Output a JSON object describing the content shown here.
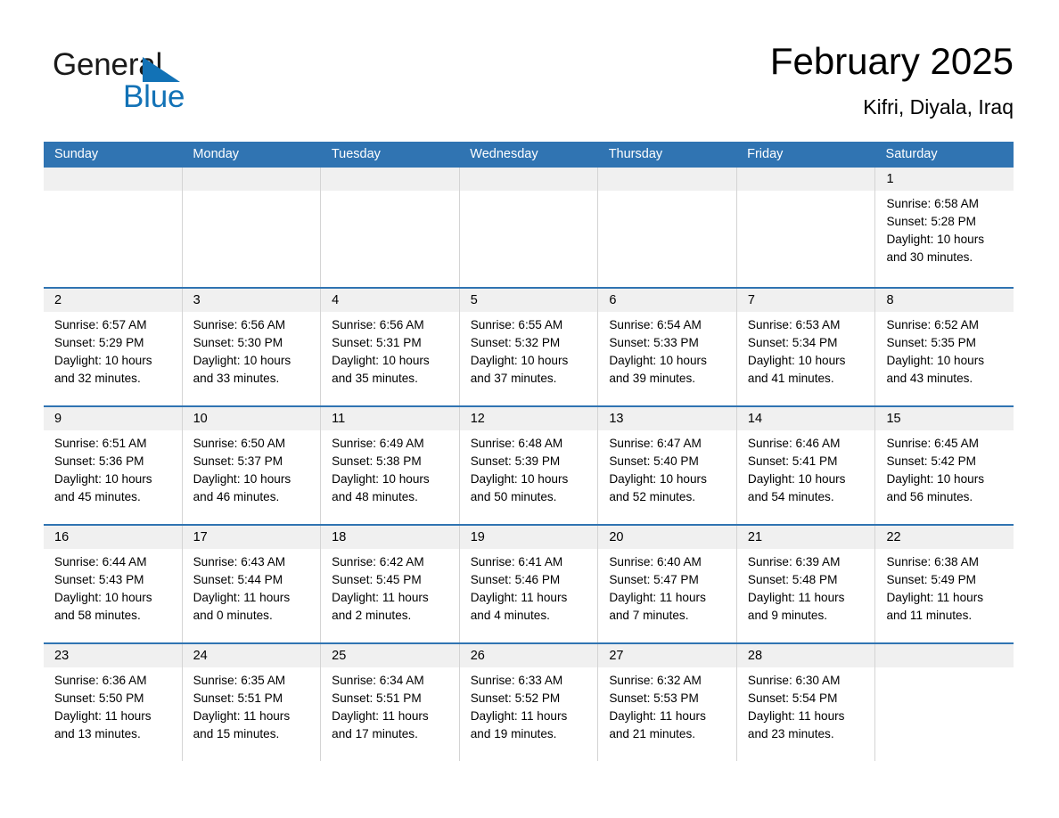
{
  "logo": {
    "word_one": "General",
    "word_two": "Blue",
    "triangle_color": "#1272b6"
  },
  "header": {
    "title": "February 2025",
    "subtitle": "Kifri, Diyala, Iraq",
    "accent_color": "#3074b2",
    "date_band_color": "#f0f0f0"
  },
  "weekday_headers": [
    "Sunday",
    "Monday",
    "Tuesday",
    "Wednesday",
    "Thursday",
    "Friday",
    "Saturday"
  ],
  "labels": {
    "sunrise_prefix": "Sunrise: ",
    "sunset_prefix": "Sunset: ",
    "daylight_prefix": "Daylight: "
  },
  "weeks": [
    [
      {
        "day": "",
        "sunrise": "",
        "sunset": "",
        "daylight": "",
        "empty": true
      },
      {
        "day": "",
        "sunrise": "",
        "sunset": "",
        "daylight": "",
        "empty": true
      },
      {
        "day": "",
        "sunrise": "",
        "sunset": "",
        "daylight": "",
        "empty": true
      },
      {
        "day": "",
        "sunrise": "",
        "sunset": "",
        "daylight": "",
        "empty": true
      },
      {
        "day": "",
        "sunrise": "",
        "sunset": "",
        "daylight": "",
        "empty": true
      },
      {
        "day": "",
        "sunrise": "",
        "sunset": "",
        "daylight": "",
        "empty": true
      },
      {
        "day": "1",
        "sunrise": "Sunrise: 6:58 AM",
        "sunset": "Sunset: 5:28 PM",
        "daylight": "Daylight: 10 hours and 30 minutes.",
        "empty": false
      }
    ],
    [
      {
        "day": "2",
        "sunrise": "Sunrise: 6:57 AM",
        "sunset": "Sunset: 5:29 PM",
        "daylight": "Daylight: 10 hours and 32 minutes.",
        "empty": false
      },
      {
        "day": "3",
        "sunrise": "Sunrise: 6:56 AM",
        "sunset": "Sunset: 5:30 PM",
        "daylight": "Daylight: 10 hours and 33 minutes.",
        "empty": false
      },
      {
        "day": "4",
        "sunrise": "Sunrise: 6:56 AM",
        "sunset": "Sunset: 5:31 PM",
        "daylight": "Daylight: 10 hours and 35 minutes.",
        "empty": false
      },
      {
        "day": "5",
        "sunrise": "Sunrise: 6:55 AM",
        "sunset": "Sunset: 5:32 PM",
        "daylight": "Daylight: 10 hours and 37 minutes.",
        "empty": false
      },
      {
        "day": "6",
        "sunrise": "Sunrise: 6:54 AM",
        "sunset": "Sunset: 5:33 PM",
        "daylight": "Daylight: 10 hours and 39 minutes.",
        "empty": false
      },
      {
        "day": "7",
        "sunrise": "Sunrise: 6:53 AM",
        "sunset": "Sunset: 5:34 PM",
        "daylight": "Daylight: 10 hours and 41 minutes.",
        "empty": false
      },
      {
        "day": "8",
        "sunrise": "Sunrise: 6:52 AM",
        "sunset": "Sunset: 5:35 PM",
        "daylight": "Daylight: 10 hours and 43 minutes.",
        "empty": false
      }
    ],
    [
      {
        "day": "9",
        "sunrise": "Sunrise: 6:51 AM",
        "sunset": "Sunset: 5:36 PM",
        "daylight": "Daylight: 10 hours and 45 minutes.",
        "empty": false
      },
      {
        "day": "10",
        "sunrise": "Sunrise: 6:50 AM",
        "sunset": "Sunset: 5:37 PM",
        "daylight": "Daylight: 10 hours and 46 minutes.",
        "empty": false
      },
      {
        "day": "11",
        "sunrise": "Sunrise: 6:49 AM",
        "sunset": "Sunset: 5:38 PM",
        "daylight": "Daylight: 10 hours and 48 minutes.",
        "empty": false
      },
      {
        "day": "12",
        "sunrise": "Sunrise: 6:48 AM",
        "sunset": "Sunset: 5:39 PM",
        "daylight": "Daylight: 10 hours and 50 minutes.",
        "empty": false
      },
      {
        "day": "13",
        "sunrise": "Sunrise: 6:47 AM",
        "sunset": "Sunset: 5:40 PM",
        "daylight": "Daylight: 10 hours and 52 minutes.",
        "empty": false
      },
      {
        "day": "14",
        "sunrise": "Sunrise: 6:46 AM",
        "sunset": "Sunset: 5:41 PM",
        "daylight": "Daylight: 10 hours and 54 minutes.",
        "empty": false
      },
      {
        "day": "15",
        "sunrise": "Sunrise: 6:45 AM",
        "sunset": "Sunset: 5:42 PM",
        "daylight": "Daylight: 10 hours and 56 minutes.",
        "empty": false
      }
    ],
    [
      {
        "day": "16",
        "sunrise": "Sunrise: 6:44 AM",
        "sunset": "Sunset: 5:43 PM",
        "daylight": "Daylight: 10 hours and 58 minutes.",
        "empty": false
      },
      {
        "day": "17",
        "sunrise": "Sunrise: 6:43 AM",
        "sunset": "Sunset: 5:44 PM",
        "daylight": "Daylight: 11 hours and 0 minutes.",
        "empty": false
      },
      {
        "day": "18",
        "sunrise": "Sunrise: 6:42 AM",
        "sunset": "Sunset: 5:45 PM",
        "daylight": "Daylight: 11 hours and 2 minutes.",
        "empty": false
      },
      {
        "day": "19",
        "sunrise": "Sunrise: 6:41 AM",
        "sunset": "Sunset: 5:46 PM",
        "daylight": "Daylight: 11 hours and 4 minutes.",
        "empty": false
      },
      {
        "day": "20",
        "sunrise": "Sunrise: 6:40 AM",
        "sunset": "Sunset: 5:47 PM",
        "daylight": "Daylight: 11 hours and 7 minutes.",
        "empty": false
      },
      {
        "day": "21",
        "sunrise": "Sunrise: 6:39 AM",
        "sunset": "Sunset: 5:48 PM",
        "daylight": "Daylight: 11 hours and 9 minutes.",
        "empty": false
      },
      {
        "day": "22",
        "sunrise": "Sunrise: 6:38 AM",
        "sunset": "Sunset: 5:49 PM",
        "daylight": "Daylight: 11 hours and 11 minutes.",
        "empty": false
      }
    ],
    [
      {
        "day": "23",
        "sunrise": "Sunrise: 6:36 AM",
        "sunset": "Sunset: 5:50 PM",
        "daylight": "Daylight: 11 hours and 13 minutes.",
        "empty": false
      },
      {
        "day": "24",
        "sunrise": "Sunrise: 6:35 AM",
        "sunset": "Sunset: 5:51 PM",
        "daylight": "Daylight: 11 hours and 15 minutes.",
        "empty": false
      },
      {
        "day": "25",
        "sunrise": "Sunrise: 6:34 AM",
        "sunset": "Sunset: 5:51 PM",
        "daylight": "Daylight: 11 hours and 17 minutes.",
        "empty": false
      },
      {
        "day": "26",
        "sunrise": "Sunrise: 6:33 AM",
        "sunset": "Sunset: 5:52 PM",
        "daylight": "Daylight: 11 hours and 19 minutes.",
        "empty": false
      },
      {
        "day": "27",
        "sunrise": "Sunrise: 6:32 AM",
        "sunset": "Sunset: 5:53 PM",
        "daylight": "Daylight: 11 hours and 21 minutes.",
        "empty": false
      },
      {
        "day": "28",
        "sunrise": "Sunrise: 6:30 AM",
        "sunset": "Sunset: 5:54 PM",
        "daylight": "Daylight: 11 hours and 23 minutes.",
        "empty": false
      },
      {
        "day": "",
        "sunrise": "",
        "sunset": "",
        "daylight": "",
        "empty": true
      }
    ]
  ]
}
